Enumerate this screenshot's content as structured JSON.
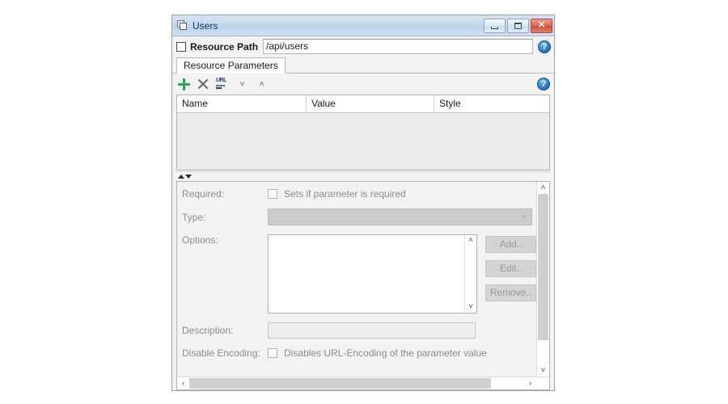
{
  "window": {
    "title": "Users",
    "icon": "window-icon",
    "controls": {
      "minimize": "minimize-button",
      "maximize": "maximize-button",
      "close": "✕"
    }
  },
  "resource_path": {
    "checkbox_checked": false,
    "label": "Resource Path",
    "value": "/api/users",
    "help": "?"
  },
  "tabs": [
    {
      "label": "Resource Parameters",
      "selected": true
    }
  ],
  "toolbar": {
    "add": "+",
    "remove": "✕",
    "url_encode_label": "URL",
    "move_down": "˅",
    "move_up": "˄",
    "help": "?"
  },
  "table": {
    "columns": [
      "Name",
      "Value",
      "Style"
    ],
    "rows": []
  },
  "splitter": {
    "collapse_up": "▲",
    "collapse_down": "▼"
  },
  "detail": {
    "required": {
      "label": "Required:",
      "checkbox_checked": false,
      "text": "Sets if parameter is required"
    },
    "type": {
      "label": "Type:",
      "value": "",
      "chevron": "˅"
    },
    "options": {
      "label": "Options:",
      "items": [],
      "scroll_up": "˄",
      "scroll_down": "˅",
      "buttons": [
        "Add..",
        "Edit..",
        "Remove.."
      ]
    },
    "description": {
      "label": "Description:",
      "value": ""
    },
    "disable_encoding": {
      "label": "Disable Encoding:",
      "checkbox_checked": false,
      "text": "Disables URL-Encoding of the parameter value"
    },
    "vscroll": {
      "up": "˄",
      "down": "˅"
    },
    "hscroll": {
      "left": "‹",
      "right": "›"
    }
  },
  "colors": {
    "title_bar": "#c5d9ee",
    "close_button": "#cd4f38",
    "add_icon": "#2aa84a",
    "help_icon": "#2a7fd0",
    "disabled_text": "#8c8c8c",
    "panel_bg": "#f2f2f2"
  }
}
